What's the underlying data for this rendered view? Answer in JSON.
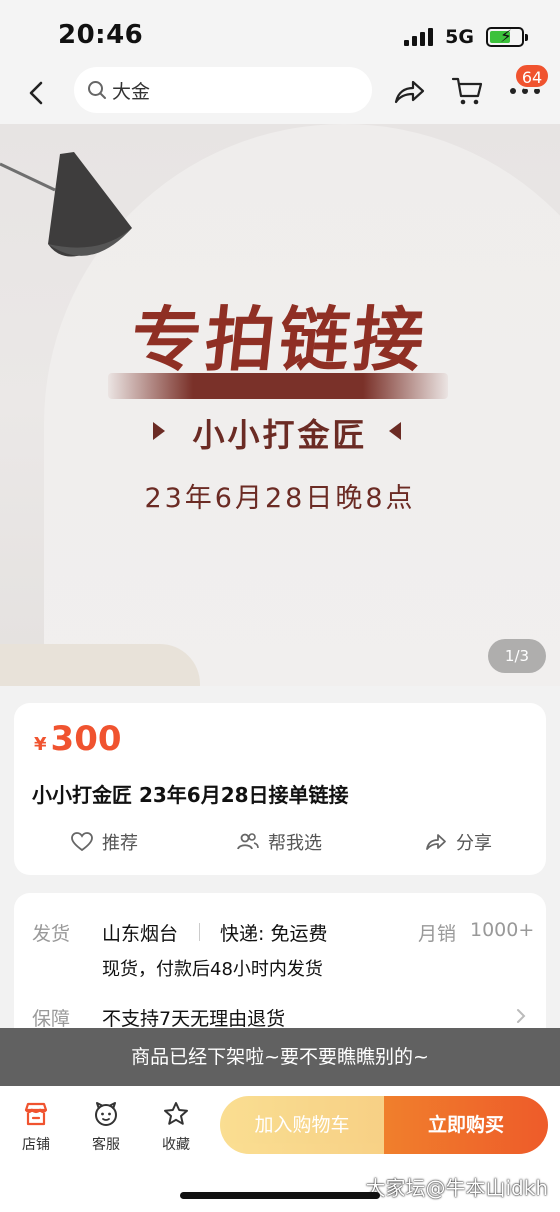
{
  "status_bar": {
    "time": "20:46",
    "network": "5G"
  },
  "nav": {
    "search_text": "大金",
    "cart_badge": "64"
  },
  "hero": {
    "title": "专拍链接",
    "shop": "小小打金匠",
    "date": "23年6月28日晚8点",
    "page_indicator": "1/3"
  },
  "product": {
    "currency": "¥",
    "price": "300",
    "title": "小小打金匠 23年6月28日接单链接",
    "actions": {
      "recommend": "推荐",
      "help_choose": "帮我选",
      "share": "分享"
    }
  },
  "shipping": {
    "ship_label": "发货",
    "origin": "山东烟台",
    "express": "快递: 免运费",
    "sales_label": "月销",
    "sales_value": "1000+",
    "dispatch": "现货，付款后48小时内发货",
    "guarantee_label": "保障",
    "guarantee_text": "不支持7天无理由退货"
  },
  "toast": "商品已经下架啦~要不要瞧瞧别的~",
  "bottom": {
    "shop": "店铺",
    "service": "客服",
    "favorite": "收藏",
    "add_cart": "加入购物车",
    "buy_now": "立即购买"
  },
  "watermark": "大家坛@牛本山idkh",
  "colors": {
    "accent": "#f0532f",
    "hero_text": "#8f2f24",
    "cart_btn": "#f7c94a",
    "buy_btn": "#ee5b2a"
  }
}
